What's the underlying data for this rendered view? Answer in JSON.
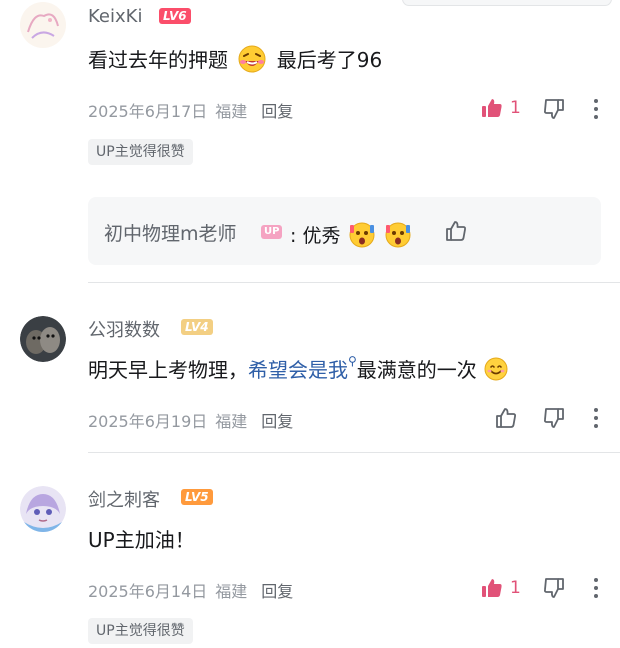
{
  "comments": [
    {
      "username": "KeixKi",
      "level": "LV6",
      "text_before": "看过去年的押题",
      "emoji": "grinning-tears-emoji",
      "text_after": "最后考了96",
      "date": "2025年6月17日",
      "location": "福建",
      "reply_label": "回复",
      "likes": "1",
      "up_tag": "UP主觉得很赞",
      "sub_reply": {
        "username": "初中物理m老师",
        "badge": "UP",
        "colon": ":",
        "text": "优秀"
      }
    },
    {
      "username": "公羽数数",
      "level": "LV4",
      "text_before": "明天早上考物理，",
      "link_text": "希望会是我",
      "text_after": "最满意的一次",
      "date": "2025年6月19日",
      "location": "福建",
      "reply_label": "回复"
    },
    {
      "username": "剑之刺客",
      "level": "LV5",
      "text": "UP主加油！",
      "date": "2025年6月14日",
      "location": "福建",
      "reply_label": "回复",
      "likes": "1",
      "up_tag": "UP主觉得很赞"
    }
  ],
  "colors": {
    "like_active": "#e15278",
    "link": "#2f5fa8",
    "muted": "#9499a0"
  }
}
